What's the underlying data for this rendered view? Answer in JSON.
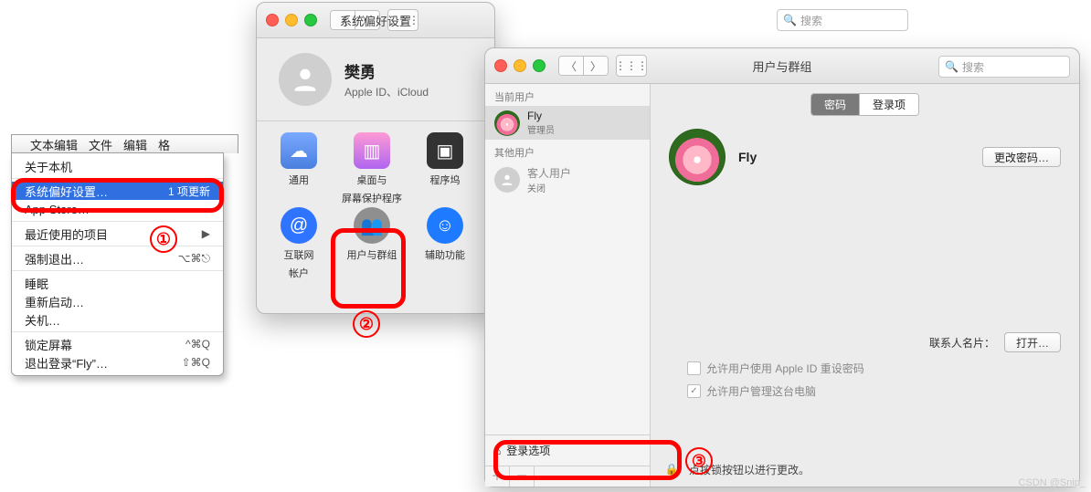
{
  "menubar": {
    "items": [
      "文本编辑",
      "文件",
      "编辑",
      "格"
    ]
  },
  "apple_menu": {
    "about": "关于本机",
    "sysprefs": "系统偏好设置…",
    "sysprefs_badge": "1 项更新",
    "appstore": "App Store…",
    "recent": "最近使用的项目",
    "forcequit": "强制退出…",
    "forcequit_key": "⌥⌘⎋",
    "sleep": "睡眠",
    "restart": "重新启动…",
    "shutdown": "关机…",
    "lock": "锁定屏幕",
    "lock_key": "^⌘Q",
    "logout": "退出登录“Fly”…",
    "logout_key": "⇧⌘Q"
  },
  "annotations": {
    "one": "①",
    "two": "②",
    "three": "③"
  },
  "sysprefs": {
    "title": "系统偏好设置",
    "search_placeholder": "搜索",
    "user_name": "樊勇",
    "user_sub": "Apple ID、iCloud",
    "icons": {
      "general": "通用",
      "desktop_l1": "桌面与",
      "desktop_l2": "屏幕保护程序",
      "dock": "程序坞",
      "internet_l1": "互联网",
      "internet_l2": "帐户",
      "users": "用户与群组",
      "accessibility": "辅助功能"
    }
  },
  "ug": {
    "title": "用户与群组",
    "search_placeholder": "搜索",
    "current_header": "当前用户",
    "other_header": "其他用户",
    "users": [
      {
        "name": "Fly",
        "role": "管理员"
      },
      {
        "name": "客人用户",
        "role": "关闭"
      }
    ],
    "login_options": "登录选项",
    "tabs": {
      "password": "密码",
      "login_items": "登录项"
    },
    "selected_user": "Fly",
    "change_password": "更改密码…",
    "contact_card_label": "联系人名片：",
    "open_btn": "打开…",
    "allow_appleid": "允许用户使用 Apple ID 重设密码",
    "allow_admin": "允许用户管理这台电脑",
    "lock_hint": "点按锁按钮以进行更改。"
  },
  "watermark": "CSDN @Snip_"
}
